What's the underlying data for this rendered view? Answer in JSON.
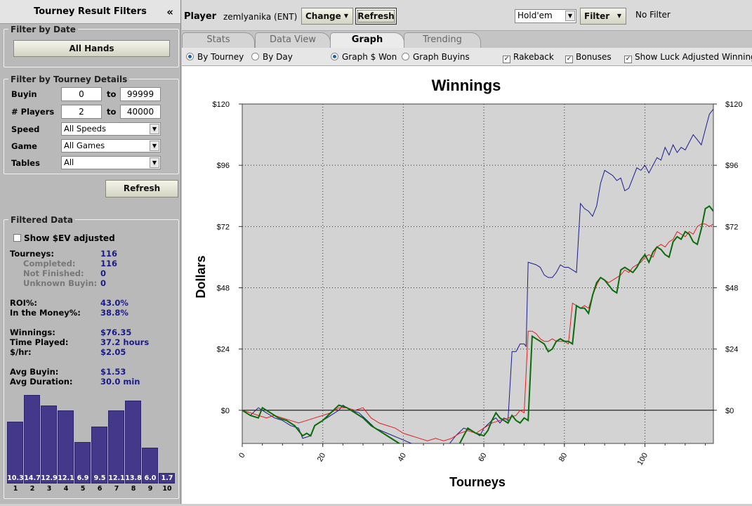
{
  "sidebar": {
    "title": "Tourney Result Filters",
    "collapse_glyph": "«",
    "date_group": {
      "title": "Filter by Date",
      "button": "All Hands"
    },
    "details_group": {
      "title": "Filter by Tourney Details",
      "buyin_label": "Buyin",
      "buyin_min": "0",
      "buyin_max": "99999",
      "players_label": "# Players",
      "players_min": "2",
      "players_max": "40000",
      "to_label": "to",
      "speed_label": "Speed",
      "speed_value": "All Speeds",
      "game_label": "Game",
      "game_value": "All Games",
      "tables_label": "Tables",
      "tables_value": "All"
    },
    "refresh_button": "Refresh",
    "filtered": {
      "title": "Filtered Data",
      "ev_checkbox": "Show $EV adjusted",
      "tourneys_label": "Tourneys:",
      "tourneys": "116",
      "completed_label": "Completed:",
      "completed": "116",
      "not_finished_label": "Not Finished:",
      "not_finished": "0",
      "unknown_label": "Unknown Buyin:",
      "unknown": "0",
      "roi_label": "ROI%:",
      "roi": "43.0%",
      "itm_label": "In the Money%:",
      "itm": "38.8%",
      "winnings_label": "Winnings:",
      "winnings": "$76.35",
      "time_label": "Time Played:",
      "time": "37.2 hours",
      "hr_label": "$/hr:",
      "hr": "$2.05",
      "avg_buyin_label": "Avg Buyin:",
      "avg_buyin": "$1.53",
      "avg_dur_label": "Avg Duration:",
      "avg_dur": "30.0 min"
    },
    "histogram": {
      "values": [
        10.3,
        14.7,
        12.9,
        12.1,
        6.9,
        9.5,
        12.1,
        13.8,
        6.0,
        1.7
      ],
      "value_labels": [
        "10.3",
        "14.7",
        "12.9",
        "12.1",
        "6.9",
        "9.5",
        "12.1",
        "13.8",
        "6.0",
        "1.7"
      ],
      "labels": [
        "1",
        "2",
        "3",
        "4",
        "5",
        "6",
        "7",
        "8",
        "9",
        "10"
      ],
      "color": "#43388a"
    }
  },
  "toolbar": {
    "player_label": "Player",
    "player_name": "zemlyanika (ENT)",
    "change_button": "Change",
    "refresh_button": "Refresh",
    "game_select": "Hold'em",
    "filter_button": "Filter",
    "filter_status": "No Filter"
  },
  "tabs": [
    "Stats",
    "Data View",
    "Graph",
    "Trending"
  ],
  "active_tab": "Graph",
  "options": {
    "by_tourney": "By Tourney",
    "by_day": "By Day",
    "graph_won": "Graph $ Won",
    "graph_buyins": "Graph Buyins",
    "rakeback": "Rakeback",
    "bonuses": "Bonuses",
    "luck_adjusted": "Show Luck Adjusted Winnings"
  },
  "chart_data": {
    "type": "line",
    "title": "Winnings",
    "xlabel": "Tourneys",
    "ylabel": "Dollars",
    "xlim": [
      0,
      117
    ],
    "ylim": [
      -13,
      120
    ],
    "yticks": [
      0,
      24,
      48,
      72,
      96,
      120
    ],
    "ytick_labels": [
      "$0",
      "$24",
      "$48",
      "$72",
      "$96",
      "$120"
    ],
    "xticks": [
      0,
      20,
      40,
      60,
      80,
      100
    ],
    "grid": true,
    "series": [
      {
        "color": "#1a1a8c",
        "width": 1,
        "points": [
          [
            0,
            0
          ],
          [
            2,
            -2
          ],
          [
            4,
            1
          ],
          [
            6,
            -1
          ],
          [
            8,
            -3
          ],
          [
            10,
            -4
          ],
          [
            12,
            -6
          ],
          [
            14,
            -7
          ],
          [
            15,
            -11
          ],
          [
            17,
            -10
          ],
          [
            18,
            -6
          ],
          [
            20,
            -4
          ],
          [
            22,
            -2
          ],
          [
            24,
            0
          ],
          [
            25,
            2
          ],
          [
            27,
            0
          ],
          [
            29,
            -1
          ],
          [
            31,
            -4
          ],
          [
            33,
            -7
          ],
          [
            36,
            -9
          ],
          [
            39,
            -11
          ],
          [
            42,
            -13
          ],
          [
            44,
            -14
          ],
          [
            46,
            -13
          ],
          [
            48,
            -15
          ],
          [
            50,
            -16
          ],
          [
            51,
            -14
          ],
          [
            53,
            -10
          ],
          [
            55,
            -7
          ],
          [
            57,
            -8
          ],
          [
            59,
            -10
          ],
          [
            60,
            -7
          ],
          [
            62,
            -4
          ],
          [
            63,
            -3
          ],
          [
            64,
            -5
          ],
          [
            65,
            -3
          ],
          [
            66,
            -4
          ],
          [
            67,
            23
          ],
          [
            68,
            23
          ],
          [
            69,
            26
          ],
          [
            70,
            26
          ],
          [
            70.5,
            25
          ],
          [
            71,
            58
          ],
          [
            73,
            57
          ],
          [
            74,
            56
          ],
          [
            75,
            53
          ],
          [
            76,
            52
          ],
          [
            77,
            52
          ],
          [
            78,
            54
          ],
          [
            79,
            57
          ],
          [
            80,
            56
          ],
          [
            81,
            56
          ],
          [
            82,
            55
          ],
          [
            83,
            54
          ],
          [
            84,
            81
          ],
          [
            85,
            79
          ],
          [
            86,
            78
          ],
          [
            87,
            76
          ],
          [
            88,
            80
          ],
          [
            89,
            89
          ],
          [
            90,
            94
          ],
          [
            91,
            93
          ],
          [
            92,
            92
          ],
          [
            93,
            90
          ],
          [
            94,
            91
          ],
          [
            95,
            86
          ],
          [
            96,
            87
          ],
          [
            97,
            91
          ],
          [
            98,
            95
          ],
          [
            99,
            94
          ],
          [
            100,
            96
          ],
          [
            101,
            93
          ],
          [
            102,
            96
          ],
          [
            103,
            99
          ],
          [
            104,
            98
          ],
          [
            105,
            103
          ],
          [
            106,
            100
          ],
          [
            107,
            104
          ],
          [
            108,
            101
          ],
          [
            109,
            103
          ],
          [
            110,
            102
          ],
          [
            111,
            105
          ],
          [
            112,
            108
          ],
          [
            113,
            106
          ],
          [
            114,
            104
          ],
          [
            115,
            110
          ],
          [
            116,
            116
          ],
          [
            117,
            118
          ],
          [
            118,
            121
          ],
          [
            119,
            118
          ],
          [
            120,
            119
          ],
          [
            121,
            115
          ]
        ]
      },
      {
        "color": "#e02020",
        "width": 1,
        "points": [
          [
            0,
            0
          ],
          [
            2,
            -1
          ],
          [
            4,
            -2
          ],
          [
            6,
            -3
          ],
          [
            8,
            -2
          ],
          [
            10,
            -3
          ],
          [
            12,
            -4
          ],
          [
            14,
            -5
          ],
          [
            16,
            -4
          ],
          [
            18,
            -3
          ],
          [
            20,
            -2
          ],
          [
            22,
            -1
          ],
          [
            24,
            1
          ],
          [
            26,
            1
          ],
          [
            28,
            0
          ],
          [
            30,
            1
          ],
          [
            32,
            -3
          ],
          [
            34,
            -5
          ],
          [
            36,
            -6
          ],
          [
            38,
            -7
          ],
          [
            40,
            -9
          ],
          [
            42,
            -10
          ],
          [
            44,
            -11
          ],
          [
            46,
            -12
          ],
          [
            48,
            -11
          ],
          [
            50,
            -12
          ],
          [
            52,
            -11
          ],
          [
            54,
            -9
          ],
          [
            56,
            -8
          ],
          [
            58,
            -9
          ],
          [
            60,
            -7
          ],
          [
            62,
            -5
          ],
          [
            64,
            -4
          ],
          [
            66,
            -3
          ],
          [
            68,
            -2
          ],
          [
            69,
            0
          ],
          [
            70,
            -1
          ],
          [
            71,
            31
          ],
          [
            72,
            31
          ],
          [
            73,
            30
          ],
          [
            74,
            28
          ],
          [
            75,
            27
          ],
          [
            76,
            27
          ],
          [
            77,
            28
          ],
          [
            78,
            27
          ],
          [
            79,
            27
          ],
          [
            80,
            27
          ],
          [
            81,
            26
          ],
          [
            82,
            42
          ],
          [
            83,
            41
          ],
          [
            84,
            40
          ],
          [
            85,
            41
          ],
          [
            86,
            40
          ],
          [
            87,
            45
          ],
          [
            88,
            49
          ],
          [
            89,
            52
          ],
          [
            90,
            51
          ],
          [
            91,
            50
          ],
          [
            92,
            51
          ],
          [
            93,
            52
          ],
          [
            94,
            53
          ],
          [
            95,
            55
          ],
          [
            96,
            54
          ],
          [
            97,
            56
          ],
          [
            98,
            57
          ],
          [
            99,
            58
          ],
          [
            100,
            60
          ],
          [
            101,
            61
          ],
          [
            102,
            60
          ],
          [
            103,
            64
          ],
          [
            104,
            65
          ],
          [
            105,
            64
          ],
          [
            106,
            66
          ],
          [
            107,
            67
          ],
          [
            108,
            70
          ],
          [
            109,
            69
          ],
          [
            110,
            68
          ],
          [
            111,
            70
          ],
          [
            112,
            69
          ],
          [
            113,
            72
          ],
          [
            114,
            73
          ],
          [
            115,
            73
          ],
          [
            116,
            72
          ],
          [
            117,
            73
          ],
          [
            118,
            72
          ]
        ]
      },
      {
        "color": "#0a6b0a",
        "width": 2,
        "points": [
          [
            0,
            0
          ],
          [
            2,
            -2
          ],
          [
            4,
            -3
          ],
          [
            5,
            1
          ],
          [
            7,
            -1
          ],
          [
            9,
            -3
          ],
          [
            11,
            -4
          ],
          [
            13,
            -6
          ],
          [
            15,
            -10
          ],
          [
            16,
            -9
          ],
          [
            17,
            -10
          ],
          [
            18,
            -6
          ],
          [
            19,
            -5
          ],
          [
            20,
            -4
          ],
          [
            22,
            -1
          ],
          [
            24,
            2
          ],
          [
            26,
            1
          ],
          [
            28,
            -1
          ],
          [
            30,
            -3
          ],
          [
            32,
            -6
          ],
          [
            34,
            -8
          ],
          [
            36,
            -10
          ],
          [
            38,
            -12
          ],
          [
            40,
            -14
          ],
          [
            42,
            -15
          ],
          [
            44,
            -16
          ],
          [
            46,
            -15
          ],
          [
            48,
            -17
          ],
          [
            50,
            -19
          ],
          [
            51,
            -16
          ],
          [
            52,
            -14
          ],
          [
            53,
            -14
          ],
          [
            54,
            -13
          ],
          [
            56,
            -7
          ],
          [
            58,
            -9
          ],
          [
            60,
            -10
          ],
          [
            61,
            -8
          ],
          [
            62,
            -4
          ],
          [
            63,
            -1
          ],
          [
            64,
            -3
          ],
          [
            65,
            -4
          ],
          [
            66,
            -5
          ],
          [
            67,
            -2
          ],
          [
            68,
            -4
          ],
          [
            69,
            -5
          ],
          [
            70,
            -3
          ],
          [
            71,
            -4
          ],
          [
            72,
            29
          ],
          [
            73,
            28
          ],
          [
            74,
            27
          ],
          [
            75,
            26
          ],
          [
            76,
            23
          ],
          [
            77,
            24
          ],
          [
            78,
            27
          ],
          [
            79,
            28
          ],
          [
            80,
            27
          ],
          [
            81,
            27
          ],
          [
            82,
            26
          ],
          [
            83,
            41
          ],
          [
            84,
            40
          ],
          [
            85,
            40
          ],
          [
            86,
            38
          ],
          [
            87,
            45
          ],
          [
            88,
            50
          ],
          [
            89,
            52
          ],
          [
            90,
            51
          ],
          [
            91,
            49
          ],
          [
            92,
            47
          ],
          [
            93,
            46
          ],
          [
            94,
            55
          ],
          [
            95,
            56
          ],
          [
            96,
            55
          ],
          [
            97,
            54
          ],
          [
            98,
            56
          ],
          [
            99,
            59
          ],
          [
            100,
            61
          ],
          [
            101,
            58
          ],
          [
            102,
            62
          ],
          [
            103,
            64
          ],
          [
            104,
            63
          ],
          [
            105,
            61
          ],
          [
            106,
            60
          ],
          [
            107,
            66
          ],
          [
            108,
            68
          ],
          [
            109,
            67
          ],
          [
            110,
            70
          ],
          [
            111,
            69
          ],
          [
            112,
            66
          ],
          [
            113,
            65
          ],
          [
            114,
            71
          ],
          [
            115,
            79
          ],
          [
            116,
            80
          ],
          [
            117,
            78
          ],
          [
            118,
            80
          ],
          [
            119,
            77
          ]
        ]
      }
    ]
  }
}
